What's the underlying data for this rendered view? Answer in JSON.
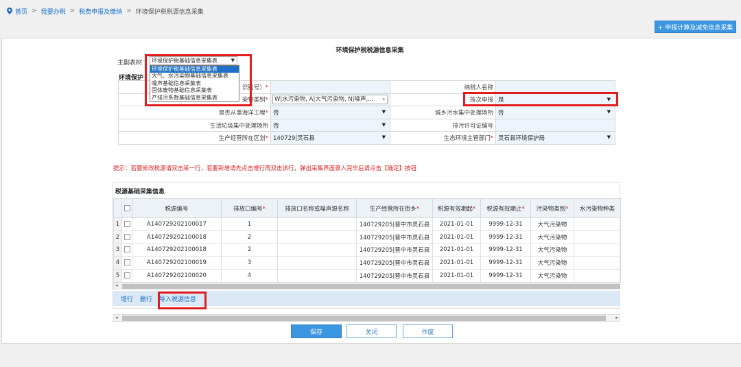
{
  "breadcrumb": {
    "home": "首页",
    "item1": "我要办税",
    "item2": "税费申报及缴纳",
    "current": "环境保护税税源信息采集",
    "separator": ">"
  },
  "top_button_label": "+ 申报计算及减免信息采集",
  "form_title": "环境保护税税源信息采集",
  "main_sub_table": {
    "label": "主副表树",
    "selected": "环境保护税基础信息采集表",
    "options": [
      "环境保护税基础信息采集表",
      "大气、水污染物基础信息采集表",
      "噪声基础信息采集表",
      "固体废物基础信息采集表",
      "产排污系数基础信息采集表"
    ]
  },
  "section_label": "环境保护",
  "info": {
    "row1": {
      "left_label": "识别号）",
      "right_label": "纳税人名称",
      "right_value": ""
    },
    "row2": {
      "left_label": "染物类别",
      "left_value": "W|水污染物, A|大气污染物, N|噪声,...",
      "right_label": "按次申报",
      "right_value": "是"
    },
    "row3": {
      "left_label": "是否从事海洋工程",
      "left_value": "否",
      "right_label": "城乡污水集中处理场所",
      "right_value": "否"
    },
    "row4": {
      "left_label": "生活垃圾集中处理场所",
      "left_value": "否",
      "right_label": "排污许可证编号",
      "right_value": ""
    },
    "row5": {
      "left_label": "生产经营所在区划",
      "left_value": "140729|灵石县",
      "right_label": "生态环境主管部门",
      "right_value": "灵石县环境保护局"
    }
  },
  "hint": "提示：若要修改税源请双击某一行，若要新增请先点击增行再双击该行，弹出采集界面录入完毕后请点击【确定】按钮",
  "grid": {
    "title": "税源基础采集信息",
    "headers": [
      "税源编号",
      "排放口编号",
      "排放口名称或噪声源名称",
      "生产经营所在街乡",
      "税源有效期起",
      "税源有效期止",
      "污染物类别",
      "水污染物种类"
    ],
    "rows": [
      {
        "n": "1",
        "id": "A140729202100017",
        "outlet": "1",
        "name": "",
        "street": "140729205|晋中市灵石县",
        "start": "2021-01-01",
        "end": "9999-12-31",
        "cat": "大气污染物",
        "water": ""
      },
      {
        "n": "2",
        "id": "A140729202100018",
        "outlet": "2",
        "name": "",
        "street": "140729205|晋中市灵石县",
        "start": "2021-01-01",
        "end": "9999-12-31",
        "cat": "大气污染物",
        "water": ""
      },
      {
        "n": "3",
        "id": "A140729202100018",
        "outlet": "2",
        "name": "",
        "street": "140729205|晋中市灵石县",
        "start": "2021-01-01",
        "end": "9999-12-31",
        "cat": "大气污染物",
        "water": ""
      },
      {
        "n": "4",
        "id": "A140729202100019",
        "outlet": "3",
        "name": "",
        "street": "140729205|晋中市灵石县",
        "start": "2021-01-01",
        "end": "9999-12-31",
        "cat": "大气污染物",
        "water": ""
      },
      {
        "n": "5",
        "id": "A140729202100020",
        "outlet": "4",
        "name": "",
        "street": "140729205|晋中市灵石县",
        "start": "2021-01-01",
        "end": "9999-12-31",
        "cat": "大气污染物",
        "water": ""
      }
    ]
  },
  "toolbar": {
    "add_row": "增行",
    "delete_row": "删行",
    "import": "导入税源信息"
  },
  "buttons": {
    "save": "保存",
    "close": "关闭",
    "void": "作废"
  },
  "icons": {
    "location": "location-pin-icon",
    "dropdown": "triangle-down-icon"
  },
  "colors": {
    "accent": "#3a96e0",
    "highlight": "#e21c1c",
    "hint": "#e22424"
  }
}
